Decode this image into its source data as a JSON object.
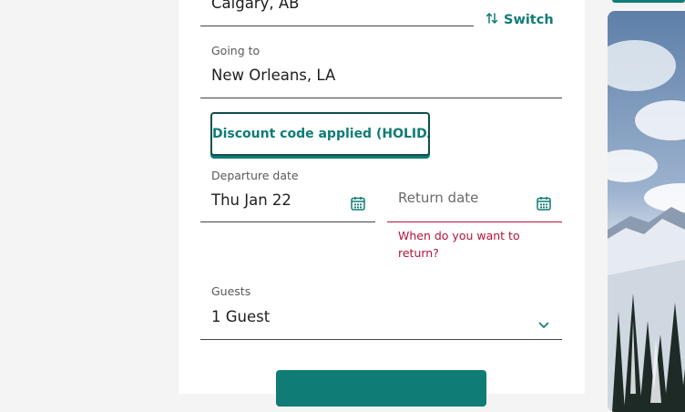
{
  "form": {
    "from_value": "Calgary, AB",
    "switch_label": "Switch",
    "going_to_label": "Going to",
    "going_to_value": "New Orleans, LA",
    "discount_label": "Discount code applied (HOLIDAY)",
    "departure_label": "Departure date",
    "departure_value": "Thu Jan 22",
    "return_placeholder": "Return date",
    "return_error": "When do you want to return?",
    "guests_label": "Guests",
    "guests_value": "1 Guest"
  },
  "colors": {
    "accent": "#0f7c76",
    "error": "#b3143b",
    "background": "#f4f4f4"
  },
  "icons": {
    "switch": "swap-arrows-icon",
    "calendar": "calendar-icon",
    "dropdown": "chevron-down-icon"
  }
}
